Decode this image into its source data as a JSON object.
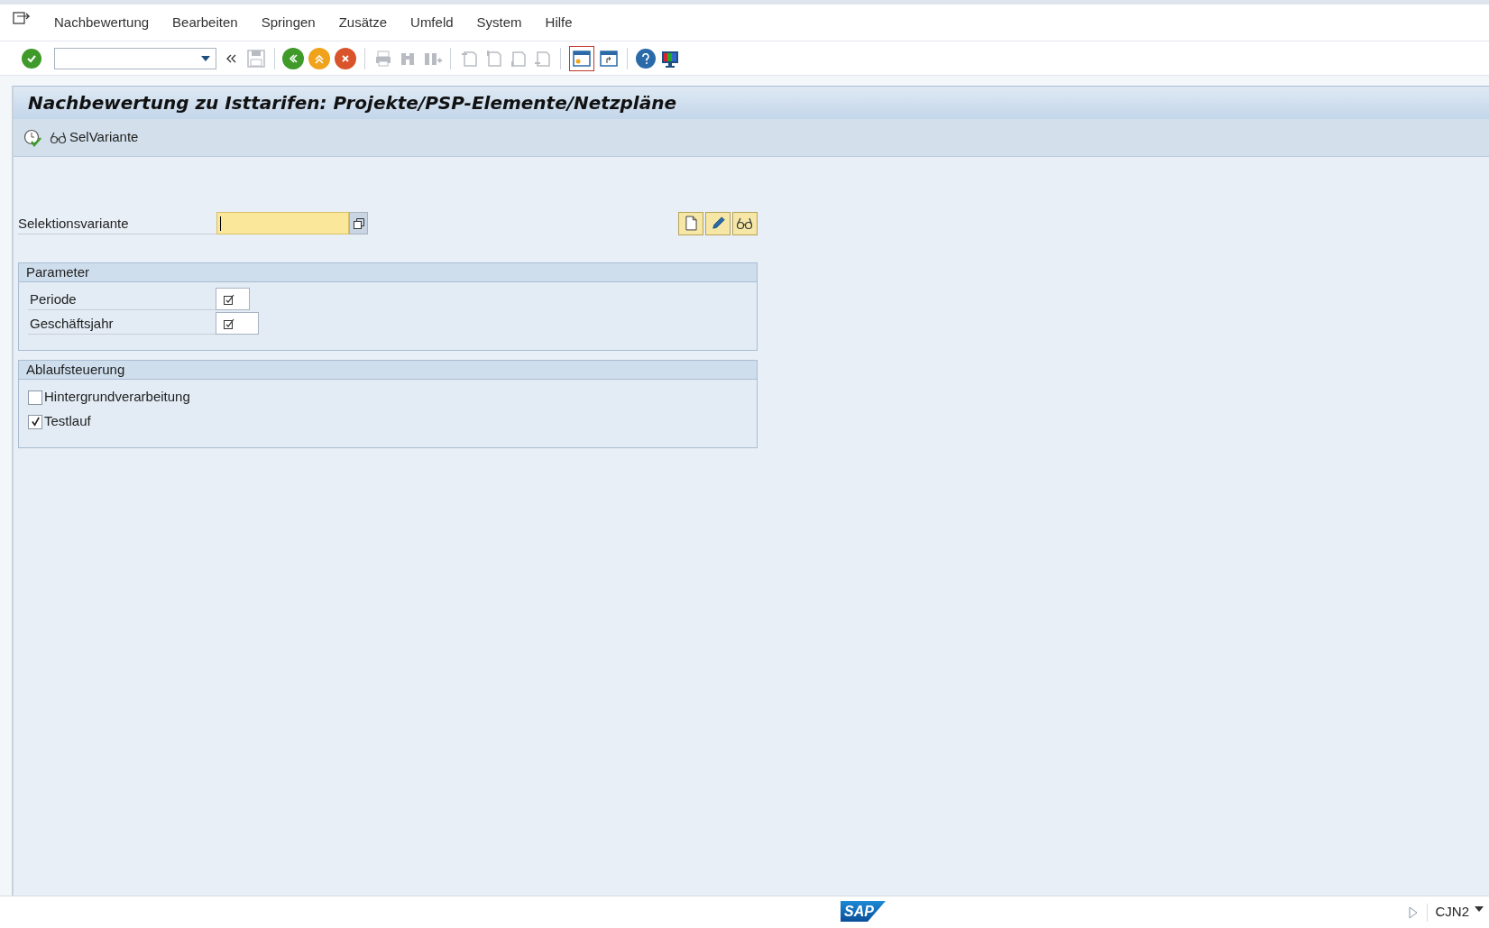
{
  "menu": [
    {
      "label": "Nachbewertung"
    },
    {
      "label": "Bearbeiten"
    },
    {
      "label": "Springen"
    },
    {
      "label": "Zusätze"
    },
    {
      "label": "Umfeld"
    },
    {
      "label": "System"
    },
    {
      "label": "Hilfe"
    }
  ],
  "title": "Nachbewertung zu Isttarifen: Projekte/PSP-Elemente/Netzpläne",
  "app_toolbar": [
    {
      "kind": "execute"
    },
    {
      "kind": "variant",
      "label": "SelVariante"
    }
  ],
  "selection_variant": {
    "label": "Selektionsvariante",
    "focused": true
  },
  "groups": [
    {
      "title": "Parameter",
      "rows": [
        {
          "kind": "field",
          "label": "Periode",
          "required": true
        },
        {
          "kind": "field",
          "label": "Geschäftsjahr",
          "required": true
        }
      ]
    },
    {
      "title": "Ablaufsteuerung",
      "rows": [
        {
          "kind": "checkbox",
          "label": "Hintergrundverarbeitung",
          "checked": false
        },
        {
          "kind": "checkbox",
          "label": "Testlauf",
          "checked": true
        }
      ]
    }
  ],
  "status_bar": {
    "logo": "SAP",
    "transaction": "CJN2"
  }
}
